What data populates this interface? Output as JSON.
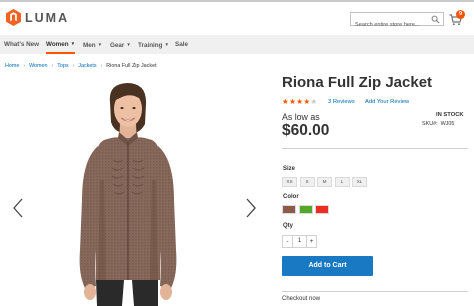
{
  "header": {
    "logo_text": "LUMA",
    "search_placeholder": "Search entire store here...",
    "cart_count": "9",
    "brand_color": "#ff5501"
  },
  "nav": {
    "items": [
      {
        "label": "What's New"
      },
      {
        "label": "Women",
        "active": true,
        "has_dropdown": true
      },
      {
        "label": "Men",
        "has_dropdown": true
      },
      {
        "label": "Gear",
        "has_dropdown": true
      },
      {
        "label": "Training",
        "has_dropdown": true
      },
      {
        "label": "Sale"
      }
    ]
  },
  "breadcrumb": {
    "items": [
      "Home",
      "Women",
      "Tops",
      "Jackets"
    ],
    "current": "Riona Full Zip Jacket"
  },
  "gallery": {
    "prev_icon": "chevron-left-icon",
    "next_icon": "chevron-right-icon"
  },
  "product": {
    "title": "Riona Full Zip Jacket",
    "rating_stars": 4,
    "rating_max": 5,
    "reviews_link": "3  Reviews",
    "add_review_link": "Add Your Review",
    "stock": "IN STOCK",
    "sku_label": "SKU#:",
    "sku": "WJ05",
    "price_label": "As low as",
    "price": "$60.00",
    "size_label": "Size",
    "sizes": [
      "XS",
      "S",
      "M",
      "L",
      "XL"
    ],
    "color_label": "Color",
    "colors": [
      "#8c5a4b",
      "#53a828",
      "#eb2d24"
    ],
    "qty_label": "Qty",
    "qty_minus": "-",
    "qty_value": "1",
    "qty_plus": "+",
    "add_to_cart": "Add to Cart",
    "checkout_now": "Checkout now"
  }
}
